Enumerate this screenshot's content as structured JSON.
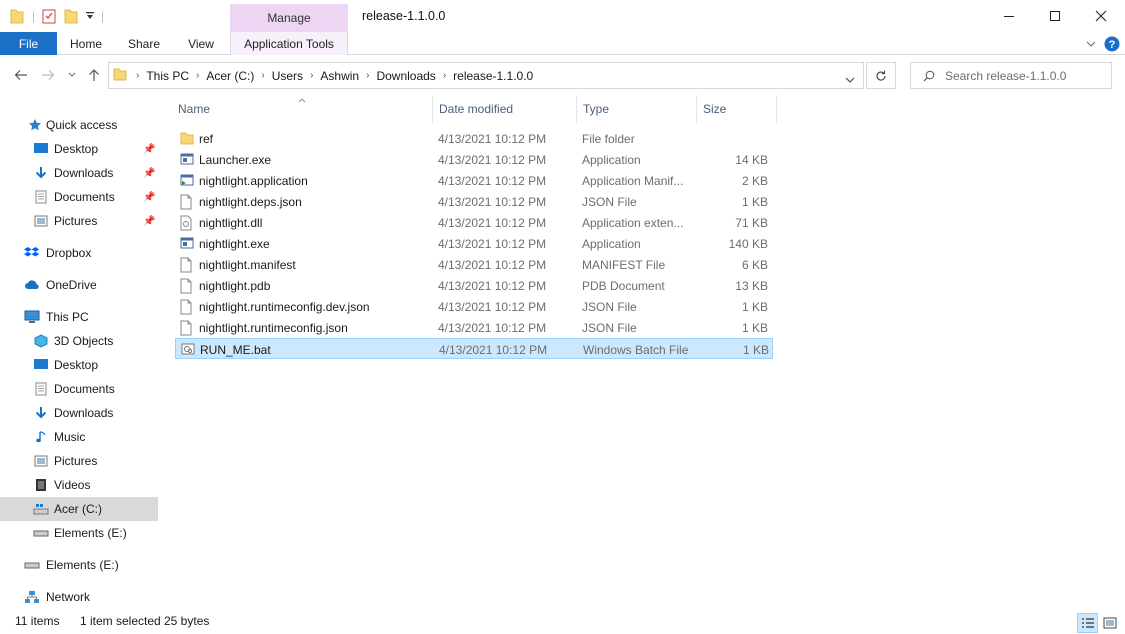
{
  "window": {
    "title": "release-1.1.0.0",
    "context_tab": "Manage",
    "controls": {
      "minimize": "—",
      "maximize": "☐",
      "close": "✕"
    }
  },
  "ribbon": {
    "tabs": [
      "File",
      "Home",
      "Share",
      "View",
      "Application Tools"
    ]
  },
  "address": {
    "crumbs": [
      "This PC",
      "Acer (C:)",
      "Users",
      "Ashwin",
      "Downloads",
      "release-1.1.0.0"
    ]
  },
  "search": {
    "placeholder": "Search release-1.1.0.0"
  },
  "navpane": {
    "quick_access": "Quick access",
    "quick_items": [
      "Desktop",
      "Downloads",
      "Documents",
      "Pictures"
    ],
    "dropbox": "Dropbox",
    "onedrive": "OneDrive",
    "this_pc": "This PC",
    "pc_items": [
      "3D Objects",
      "Desktop",
      "Documents",
      "Downloads",
      "Music",
      "Pictures",
      "Videos",
      "Acer (C:)",
      "Elements (E:)"
    ],
    "elements_drive": "Elements (E:)",
    "network": "Network"
  },
  "columns": {
    "name": "Name",
    "date": "Date modified",
    "type": "Type",
    "size": "Size"
  },
  "files": [
    {
      "name": "ref",
      "date": "4/13/2021 10:12 PM",
      "type": "File folder",
      "size": "",
      "icon": "folder-icon"
    },
    {
      "name": "Launcher.exe",
      "date": "4/13/2021 10:12 PM",
      "type": "Application",
      "size": "14 KB",
      "icon": "exe-icon"
    },
    {
      "name": "nightlight.application",
      "date": "4/13/2021 10:12 PM",
      "type": "Application Manif...",
      "size": "2 KB",
      "icon": "manifest-icon"
    },
    {
      "name": "nightlight.deps.json",
      "date": "4/13/2021 10:12 PM",
      "type": "JSON File",
      "size": "1 KB",
      "icon": "file-icon"
    },
    {
      "name": "nightlight.dll",
      "date": "4/13/2021 10:12 PM",
      "type": "Application exten...",
      "size": "71 KB",
      "icon": "dll-icon"
    },
    {
      "name": "nightlight.exe",
      "date": "4/13/2021 10:12 PM",
      "type": "Application",
      "size": "140 KB",
      "icon": "exe-icon"
    },
    {
      "name": "nightlight.manifest",
      "date": "4/13/2021 10:12 PM",
      "type": "MANIFEST File",
      "size": "6 KB",
      "icon": "file-icon"
    },
    {
      "name": "nightlight.pdb",
      "date": "4/13/2021 10:12 PM",
      "type": "PDB Document",
      "size": "13 KB",
      "icon": "file-icon"
    },
    {
      "name": "nightlight.runtimeconfig.dev.json",
      "date": "4/13/2021 10:12 PM",
      "type": "JSON File",
      "size": "1 KB",
      "icon": "file-icon"
    },
    {
      "name": "nightlight.runtimeconfig.json",
      "date": "4/13/2021 10:12 PM",
      "type": "JSON File",
      "size": "1 KB",
      "icon": "file-icon"
    },
    {
      "name": "RUN_ME.bat",
      "date": "4/13/2021 10:12 PM",
      "type": "Windows Batch File",
      "size": "1 KB",
      "icon": "bat-icon",
      "selected": true
    }
  ],
  "status": {
    "items": "11 items",
    "selected": "1 item selected",
    "size": "25 bytes"
  },
  "colors": {
    "accent": "#1a6fc6",
    "selection": "#cce8ff",
    "context_tab": "#ecd6f4"
  }
}
